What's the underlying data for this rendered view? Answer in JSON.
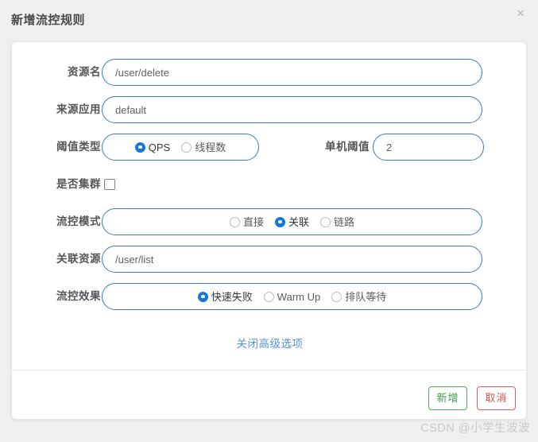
{
  "dialog": {
    "title": "新增流控规则",
    "close_icon": "×"
  },
  "form": {
    "resource_name": {
      "label": "资源名",
      "value": "/user/delete",
      "placeholder": "资源名"
    },
    "origin_app": {
      "label": "来源应用",
      "value": "default",
      "placeholder": "来源应用"
    },
    "threshold_type": {
      "label": "阈值类型",
      "options": [
        {
          "label": "QPS",
          "selected": true
        },
        {
          "label": "线程数",
          "selected": false
        }
      ]
    },
    "single_threshold": {
      "label": "单机阈值",
      "value": "2",
      "placeholder": "单机阈值"
    },
    "is_cluster": {
      "label": "是否集群",
      "checked": false
    },
    "flow_mode": {
      "label": "流控模式",
      "options": [
        {
          "label": "直接",
          "selected": false
        },
        {
          "label": "关联",
          "selected": true
        },
        {
          "label": "链路",
          "selected": false
        }
      ]
    },
    "ref_resource": {
      "label": "关联资源",
      "value": "/user/list",
      "placeholder": "关联资源"
    },
    "flow_effect": {
      "label": "流控效果",
      "options": [
        {
          "label": "快速失败",
          "selected": true
        },
        {
          "label": "Warm Up",
          "selected": false
        },
        {
          "label": "排队等待",
          "selected": false
        }
      ]
    },
    "advanced_link": "关闭高级选项"
  },
  "footer": {
    "submit_label": "新增",
    "cancel_label": "取消"
  },
  "watermark": "CSDN @小学生波波",
  "colors": {
    "input_border": "#3b7cb8",
    "radio_accent": "#1677d9",
    "link": "#5b8fd0",
    "submit": "#3f9b4b",
    "cancel": "#d9534f",
    "page_bg": "#efefef",
    "card_bg": "#ffffff"
  }
}
